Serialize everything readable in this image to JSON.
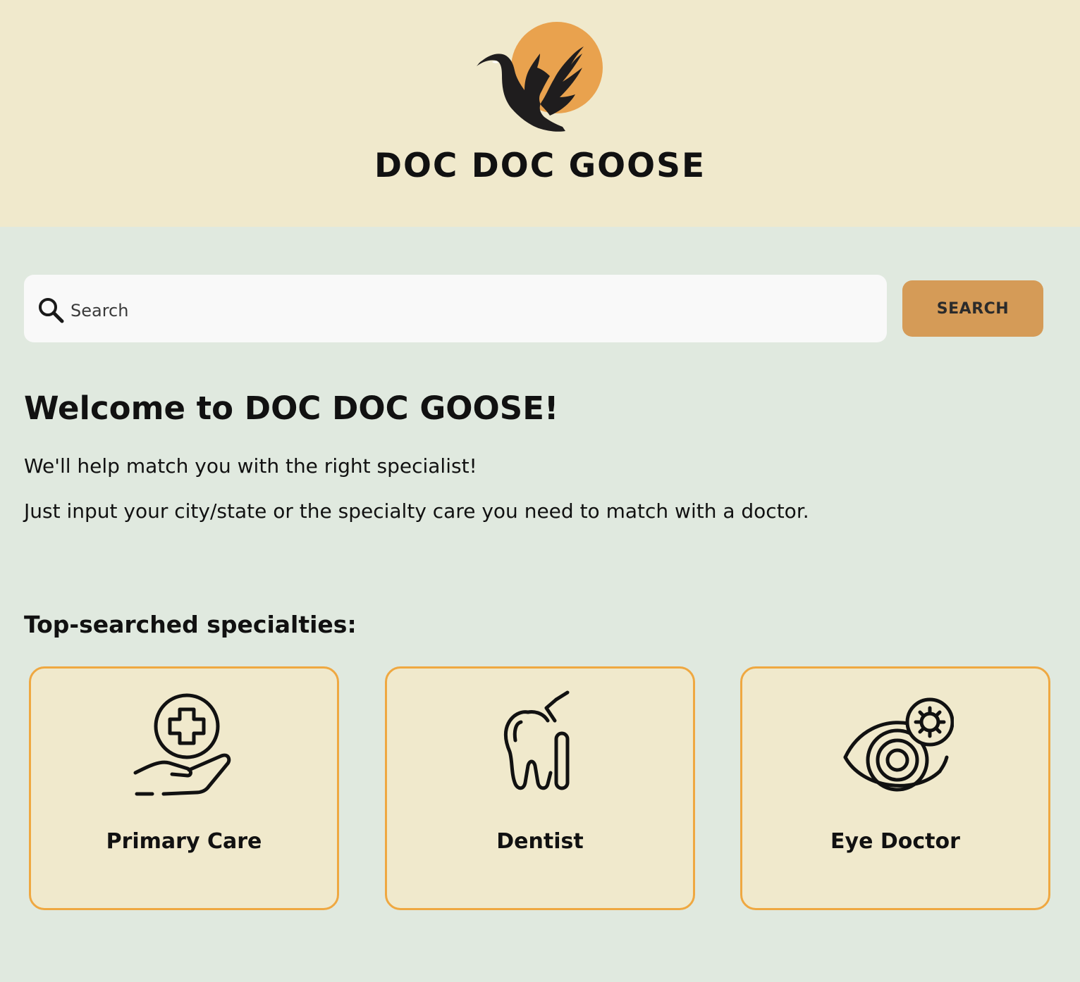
{
  "header": {
    "brand_title": "DOC DOC GOOSE",
    "logo_icon": "goose-sun-logo"
  },
  "search": {
    "placeholder": "Search",
    "value": "",
    "button_label": "SEARCH",
    "icon": "search-icon"
  },
  "main": {
    "welcome_title": "Welcome to DOC DOC GOOSE!",
    "intro_lines": [
      "We'll help match you with the right specialist!",
      "Just input your city/state or the specialty care you need to match with a doctor."
    ],
    "specialties_heading": "Top-searched specialties:",
    "specialties": [
      {
        "label": "Primary Care",
        "icon": "medical-hand-icon"
      },
      {
        "label": "Dentist",
        "icon": "tooth-icon"
      },
      {
        "label": "Eye Doctor",
        "icon": "eye-lens-icon"
      }
    ]
  },
  "colors": {
    "header_bg": "#f0e9cc",
    "page_bg": "#e0e9df",
    "search_bg": "#f9f9f9",
    "button_bg": "#d59b57",
    "card_bg": "#f0e9cc",
    "card_border": "#efa841",
    "logo_sun": "#e9a24e",
    "text": "#111111"
  }
}
